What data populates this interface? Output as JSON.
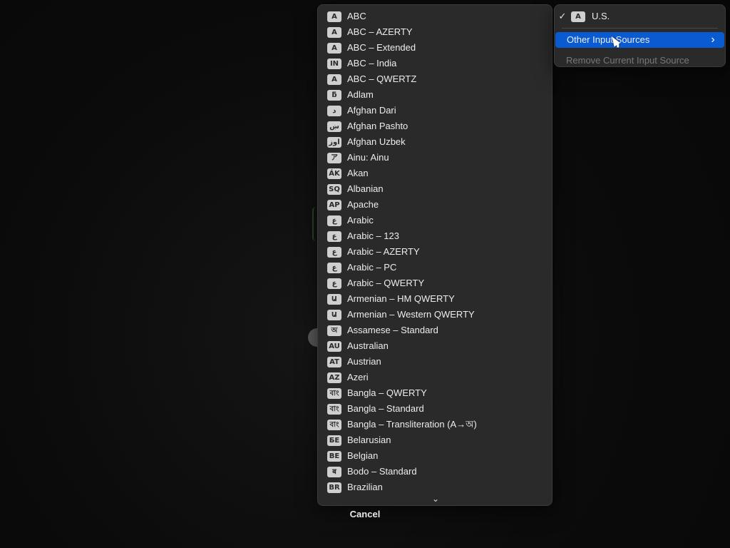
{
  "main_menu": {
    "current": {
      "check": "✓",
      "badge": "A",
      "label": "U.S."
    },
    "other": {
      "label": "Other Input Sources",
      "chevron": "›"
    },
    "remove": {
      "label": "Remove Current Input Source"
    }
  },
  "submenu": {
    "items": [
      {
        "badge": "A",
        "label": "ABC"
      },
      {
        "badge": "A",
        "label": "ABC – AZERTY"
      },
      {
        "badge": "A",
        "label": "ABC – Extended"
      },
      {
        "badge": "IN",
        "label": "ABC – India"
      },
      {
        "badge": "A",
        "label": "ABC – QWERTZ"
      },
      {
        "badge": "ƃ",
        "label": "Adlam"
      },
      {
        "badge": "د",
        "label": "Afghan Dari"
      },
      {
        "badge": "ښ",
        "label": "Afghan Pashto"
      },
      {
        "badge": "اوز",
        "label": "Afghan Uzbek"
      },
      {
        "badge": "ア",
        "label": "Ainu: Ainu"
      },
      {
        "badge": "ÁK",
        "label": "Akan"
      },
      {
        "badge": "SQ",
        "label": "Albanian"
      },
      {
        "badge": "AP",
        "label": "Apache"
      },
      {
        "badge": "ع",
        "label": "Arabic"
      },
      {
        "badge": "ع",
        "label": "Arabic – 123"
      },
      {
        "badge": "ع",
        "label": "Arabic – AZERTY"
      },
      {
        "badge": "ع",
        "label": "Arabic – PC"
      },
      {
        "badge": "ع",
        "label": "Arabic – QWERTY"
      },
      {
        "badge": "Ա",
        "label": "Armenian – HM QWERTY"
      },
      {
        "badge": "Ա",
        "label": "Armenian – Western QWERTY"
      },
      {
        "badge": "অ",
        "label": "Assamese – Standard"
      },
      {
        "badge": "AU",
        "label": "Australian"
      },
      {
        "badge": "AT",
        "label": "Austrian"
      },
      {
        "badge": "AZ",
        "label": "Azeri"
      },
      {
        "badge": "বাং",
        "label": "Bangla – QWERTY"
      },
      {
        "badge": "বাং",
        "label": "Bangla – Standard"
      },
      {
        "badge": "বাং",
        "label": "Bangla – Transliteration (A→অ)"
      },
      {
        "badge": "БЕ",
        "label": "Belarusian"
      },
      {
        "badge": "BE",
        "label": "Belgian"
      },
      {
        "badge": "ब",
        "label": "Bodo – Standard"
      },
      {
        "badge": "BR",
        "label": "Brazilian"
      }
    ],
    "scroll_indicator": "⌄"
  },
  "cancel": {
    "label": "Cancel"
  }
}
